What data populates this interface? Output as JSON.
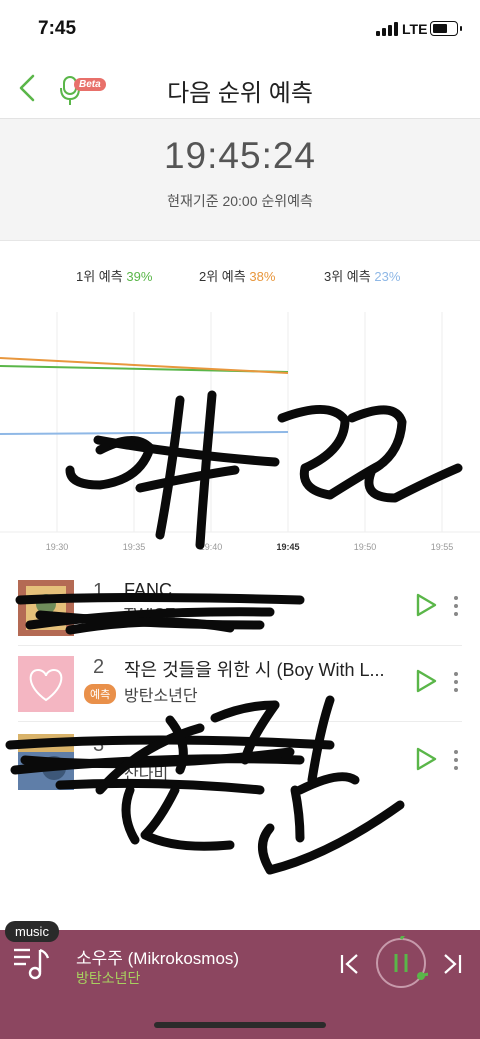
{
  "status_bar": {
    "time": "7:45",
    "network": "LTE"
  },
  "header": {
    "title": "다음 순위 예측",
    "beta_label": "Beta"
  },
  "timer": {
    "current": "19:45:24",
    "subtitle": "현재기준 20:00 순위예측"
  },
  "legend": [
    {
      "label": "1위 예측",
      "percent": "39%",
      "color": "#5ab649"
    },
    {
      "label": "2위 예측",
      "percent": "38%",
      "color": "#e8973d"
    },
    {
      "label": "3위 예측",
      "percent": "23%",
      "color": "#8fb8e6"
    }
  ],
  "chart_data": {
    "type": "line",
    "x": [
      "19:30",
      "19:35",
      "19:40",
      "19:45",
      "19:50",
      "19:55"
    ],
    "highlight_x": "19:45",
    "series": [
      {
        "name": "1위 예측",
        "color": "#5ab649"
      },
      {
        "name": "2위 예측",
        "color": "#e8973d"
      },
      {
        "name": "3위 예측",
        "color": "#8fb8e6"
      }
    ],
    "grid": true
  },
  "list": [
    {
      "rank": "1",
      "title": "FANC",
      "artist": "TWICE",
      "thumb_colors": [
        "#b46a54",
        "#e5c07a",
        "#6f8d5a"
      ]
    },
    {
      "rank": "2",
      "title": "작은 것들을 위한 시 (Boy With L...",
      "artist": "방탄소년단",
      "tag": "예측",
      "thumb_colors": [
        "#f4b6c2",
        "#f8d5dd",
        "#ffffff"
      ]
    },
    {
      "rank": "3",
      "title": "",
      "artist": "잔나비",
      "thumb_colors": [
        "#5f7ea8",
        "#d9b36a",
        "#3d5778"
      ]
    }
  ],
  "player": {
    "tab_label": "music",
    "now_playing_title": "소우주 (Mikrokosmos)",
    "now_playing_artist": "방탄소년단",
    "accent": "#5ab649",
    "background": "#8c4660"
  }
}
